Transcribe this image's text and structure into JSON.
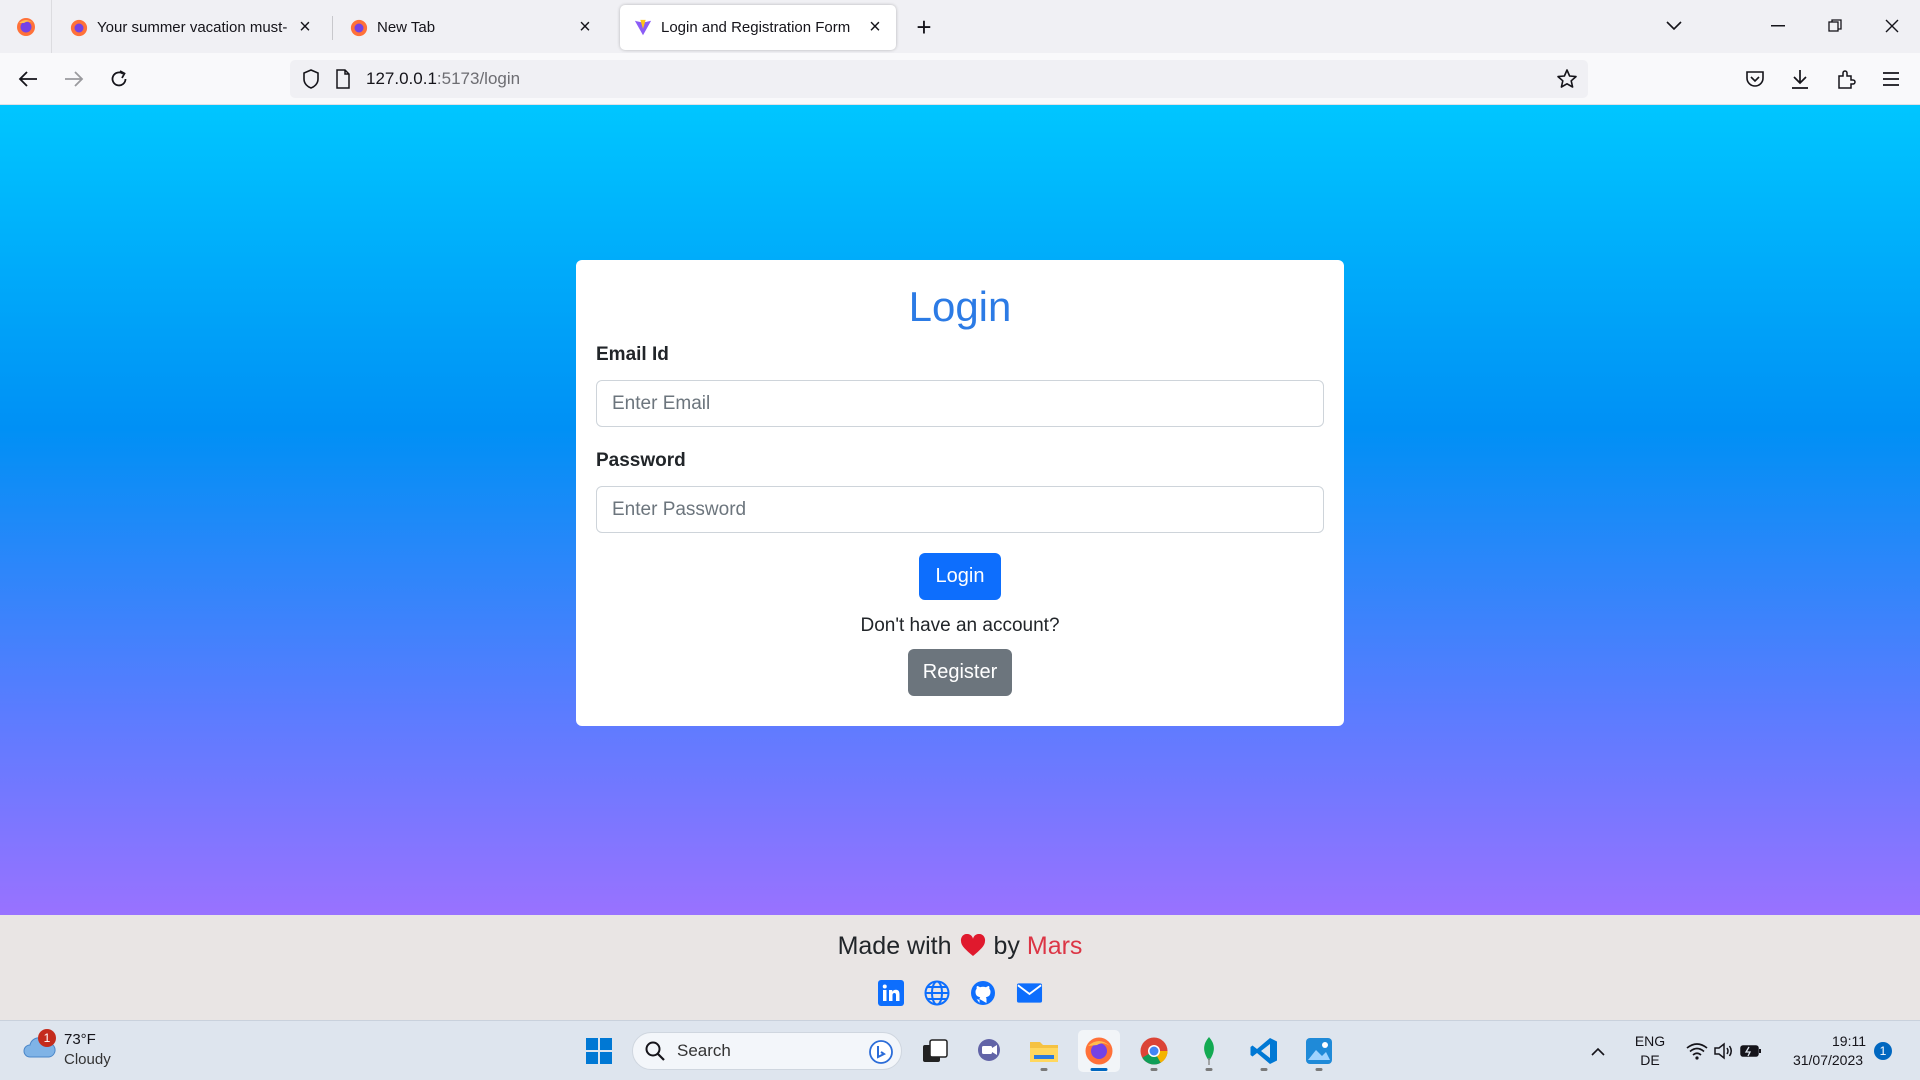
{
  "browser": {
    "tabs": [
      {
        "title": "Your summer vacation must-have"
      },
      {
        "title": "New Tab"
      },
      {
        "title": "Login and Registration Form"
      }
    ],
    "url_host": "127.0.0.1",
    "url_rest": ":5173/login"
  },
  "login": {
    "title": "Login",
    "email_label": "Email Id",
    "email_placeholder": "Enter Email",
    "password_label": "Password",
    "password_placeholder": "Enter Password",
    "login_button": "Login",
    "no_account_text": "Don't have an account?",
    "register_button": "Register"
  },
  "footer": {
    "made_with": "Made with",
    "by": "by",
    "author": "Mars",
    "socials": [
      "linkedin-icon",
      "globe-icon",
      "github-icon",
      "email-icon"
    ]
  },
  "taskbar": {
    "weather_temp": "73°F",
    "weather_condition": "Cloudy",
    "weather_badge": "1",
    "search_label": "Search",
    "language_top": "ENG",
    "language_bottom": "DE",
    "time": "19:11",
    "date": "31/07/2023",
    "notification_count": "1"
  },
  "colors": {
    "accent": "#0d6efd",
    "title_blue": "#2c7be5",
    "secondary": "#6c757d",
    "author_red": "#dc3545",
    "heart": "#e0192d"
  }
}
